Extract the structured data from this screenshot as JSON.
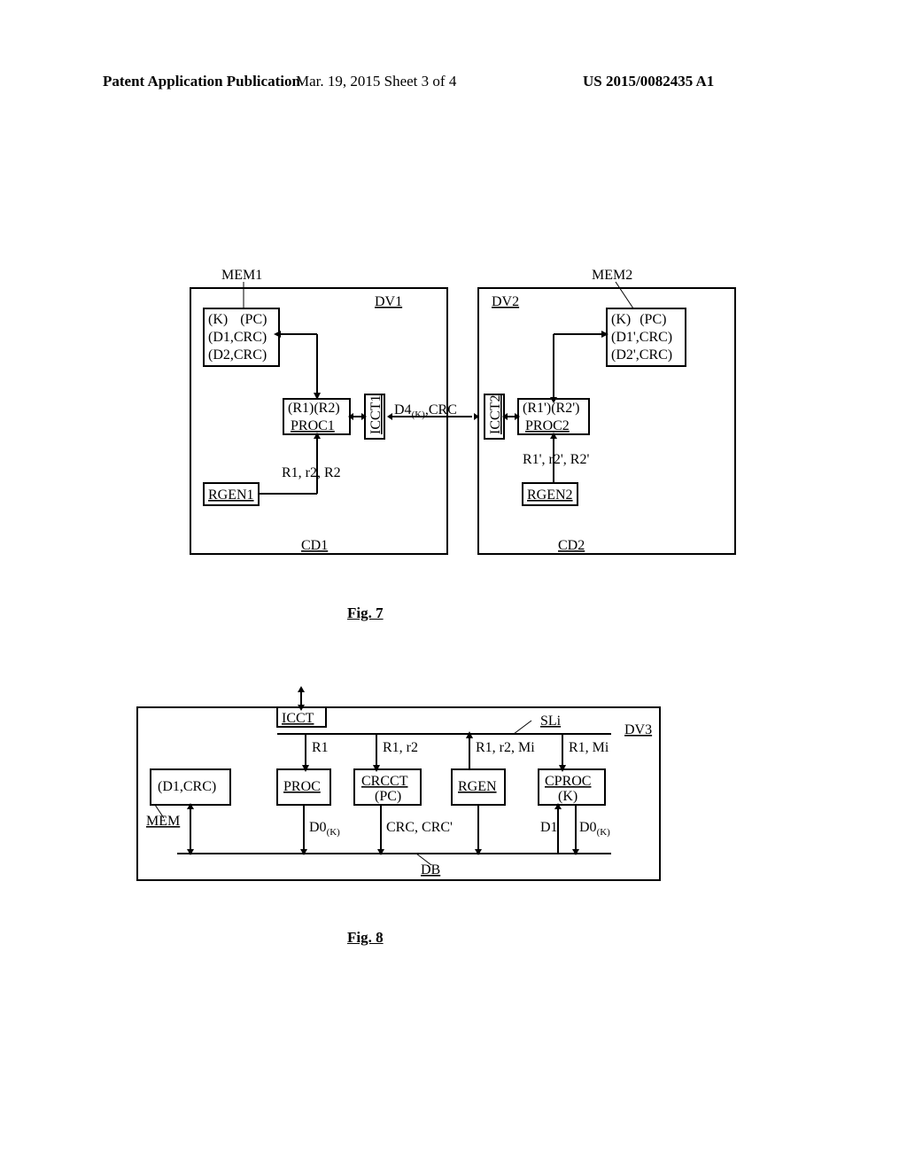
{
  "header": {
    "left": "Patent Application Publication",
    "mid": "Mar. 19, 2015  Sheet 3 of 4",
    "right": "US 2015/0082435 A1"
  },
  "fig7": {
    "caption": "Fig. 7",
    "left_mem": "MEM1",
    "right_mem": "MEM2",
    "dv1": "DV1",
    "dv2": "DV2",
    "mem1_line1a": "(K)",
    "mem1_line1b": "(PC)",
    "mem1_line2": "(D1,CRC)",
    "mem1_line3": "(D2,CRC)",
    "mem2_line1a": "(K)",
    "mem2_line1b": "(PC)",
    "mem2_line2": "(D1',CRC)",
    "mem2_line3": "(D2',CRC)",
    "r1r2": "(R1)(R2)",
    "proc1": "PROC1",
    "icct1": "ICCT1",
    "mid_sig": "D4(K),CRC",
    "icct2": "ICCT2",
    "r1pr2p": "(R1')(R2')",
    "proc2": "PROC2",
    "r1r2R2_left": "R1, r2, R2",
    "r1r2R2_right": "R1', r2', R2'",
    "rgen1": "RGEN1",
    "rgen2": "RGEN2",
    "cd1": "CD1",
    "cd2": "CD2"
  },
  "fig8": {
    "caption": "Fig. 8",
    "icct": "ICCT",
    "sli": "SLi",
    "dv3": "DV3",
    "sig_r1": "R1",
    "sig_r1r2": "R1, r2",
    "sig_r1r2mi": "R1, r2, Mi",
    "sig_r1mi": "R1, Mi",
    "d1crc": "(D1,CRC)",
    "proc": "PROC",
    "crcct": "CRCCT",
    "pc": "(PC)",
    "rgen": "RGEN",
    "cproc": "CPROC",
    "k": "(K)",
    "mem": "MEM",
    "d0k": "D0(K)",
    "crccrc": "CRC, CRC'",
    "d1d0k": "D1 D0(K)",
    "db": "DB"
  }
}
